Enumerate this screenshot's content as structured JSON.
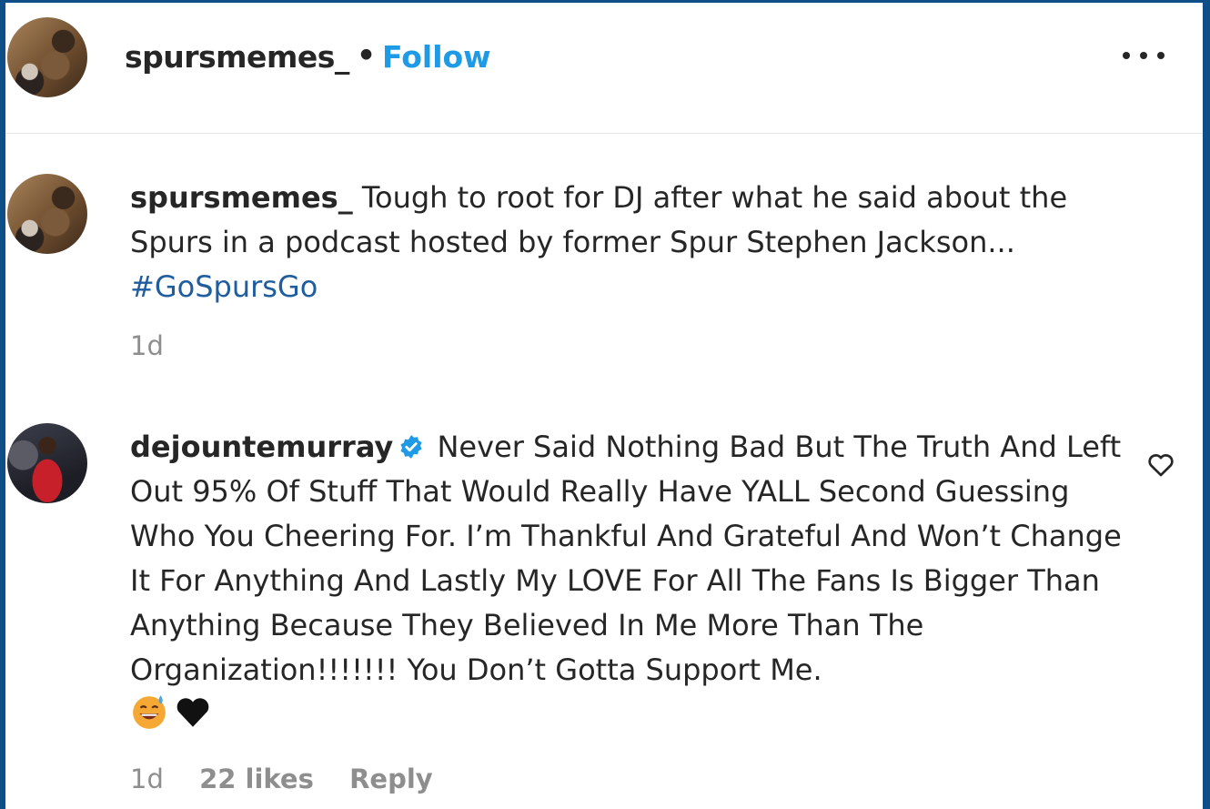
{
  "header": {
    "username": "spursmemes_",
    "separator": "•",
    "follow_label": "Follow"
  },
  "caption": {
    "username": "spursmemes_",
    "text": "Tough to root for DJ after what he said about the Spurs in a podcast hosted by former Spur Stephen Jackson...",
    "hashtag": "#GoSpursGo",
    "time": "1d"
  },
  "comment": {
    "username": "dejountemurray",
    "verified": true,
    "text": "Never Said Nothing Bad But The Truth And Left Out 95% Of Stuff That Would Really Have YALL Second Guessing Who You Cheering For. I’m Thankful And Grateful And Won’t Change It For Anything And Lastly My LOVE For All The Fans Is Bigger Than Anything Because They Believed In Me More Than The Organization!!!!!!! You Don’t Gotta Support Me.",
    "emojis": [
      "grinning-sweat-emoji",
      "black-heart-emoji"
    ],
    "time": "1d",
    "likes": "22 likes",
    "reply_label": "Reply"
  },
  "icons": {
    "more": "more-options-icon",
    "like": "heart-outline-icon",
    "verified": "verified-badge-icon"
  },
  "colors": {
    "follow": "#1e9ae6",
    "hashtag": "#1f5d9e",
    "verified": "#1e9ae6",
    "meta_gray": "#8e8e8e"
  }
}
